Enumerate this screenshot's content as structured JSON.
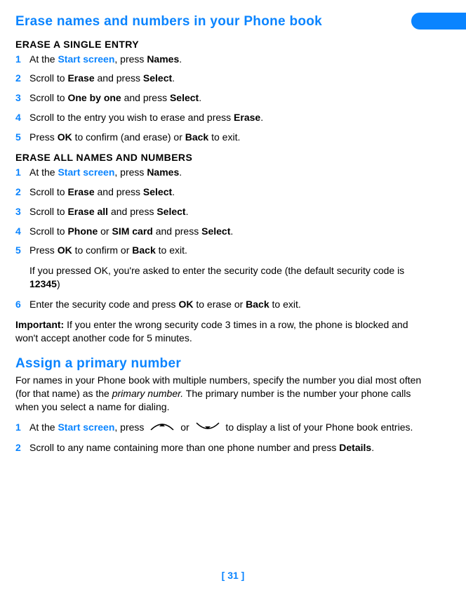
{
  "heading1": "Erase names and numbers in your Phone book",
  "sectionA": {
    "title": "ERASE A SINGLE ENTRY",
    "steps": [
      {
        "n": "1",
        "pre": "At the ",
        "link": "Start screen",
        "mid1": ", press ",
        "b1": "Names",
        "post1": "."
      },
      {
        "n": "2",
        "pre": "Scroll to ",
        "b1": "Erase",
        "mid1": " and press ",
        "b2": "Select",
        "post1": "."
      },
      {
        "n": "3",
        "pre": "Scroll to ",
        "b1": "One by one",
        "mid1": " and press ",
        "b2": "Select",
        "post1": "."
      },
      {
        "n": "4",
        "pre": "Scroll to the entry you wish to erase and press ",
        "b1": "Erase",
        "post1": "."
      },
      {
        "n": "5",
        "pre": "Press ",
        "b1": "OK",
        "mid1": " to confirm (and erase) or ",
        "b2": "Back",
        "post1": " to exit."
      }
    ]
  },
  "sectionB": {
    "title": "ERASE ALL NAMES AND NUMBERS",
    "steps": [
      {
        "n": "1",
        "pre": "At the ",
        "link": "Start screen",
        "mid1": ", press ",
        "b1": "Names",
        "post1": "."
      },
      {
        "n": "2",
        "pre": "Scroll to ",
        "b1": "Erase",
        "mid1": " and press ",
        "b2": "Select",
        "post1": "."
      },
      {
        "n": "3",
        "pre": "Scroll to ",
        "b1": "Erase all",
        "mid1": " and press ",
        "b2": "Select",
        "post1": "."
      },
      {
        "n": "4",
        "pre": "Scroll to ",
        "b1": "Phone",
        "mid1": " or ",
        "b2": "SIM card",
        "mid2": " and press ",
        "b3": "Select",
        "post1": "."
      },
      {
        "n": "5",
        "pre": "Press ",
        "b1": "OK",
        "mid1": " to confirm or ",
        "b2": "Back",
        "post1": " to exit."
      }
    ],
    "note_pre": "If you pressed OK, you're asked to enter the security code (the default security code is ",
    "note_b": "12345",
    "note_post": ")",
    "step6": {
      "n": "6",
      "pre": "Enter the security code and press ",
      "b1": "OK",
      "mid1": " to erase or ",
      "b2": "Back",
      "post1": " to exit."
    }
  },
  "important": {
    "label": "Important:",
    "text": " If you enter the wrong security code 3 times in a row, the phone is blocked and won't accept another code for 5 minutes."
  },
  "heading2": "Assign a primary number",
  "intro": {
    "pre": "For names in your Phone book with multiple numbers, specify the number you dial most often (for that name) as the ",
    "i": "primary number.",
    "post": " The primary number is the number your phone calls when you select a name for dialing."
  },
  "sectionC": {
    "step1": {
      "n": "1",
      "pre": "At the ",
      "link": "Start screen",
      "mid1": ", press ",
      "mid2": " or ",
      "post": " to display a list of your Phone book entries."
    },
    "step2": {
      "n": "2",
      "pre": "Scroll to any name containing more than one phone number and press ",
      "b1": "Details",
      "post1": "."
    }
  },
  "page_number": "[ 31 ]"
}
